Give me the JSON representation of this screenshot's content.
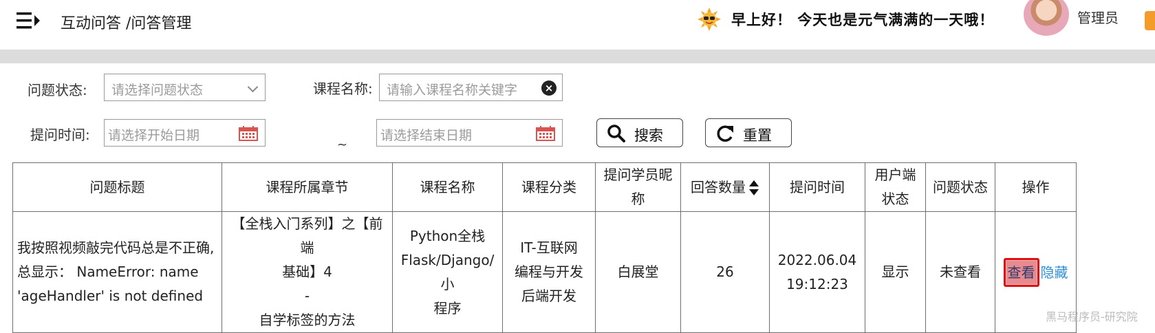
{
  "header": {
    "breadcrumb": "互动问答 /问答管理",
    "greeting": "早上好！ 今天也是元气满满的一天哦！",
    "username": "管理员"
  },
  "filters": {
    "status_label": "问题状态:",
    "status_placeholder": "请选择问题状态",
    "course_label": "课程名称:",
    "course_placeholder": "请输入课程名称关键字",
    "time_label": "提问时间:",
    "start_placeholder": "请选择开始日期",
    "range_sep": "~",
    "end_placeholder": "请选择结束日期",
    "search_label": "搜索",
    "reset_label": "重置"
  },
  "table": {
    "headers": {
      "title": "问题标题",
      "chapter": "课程所属章节",
      "course": "课程名称",
      "category": "课程分类",
      "student": "提问学员昵称",
      "answers": "回答数量",
      "time": "提问时间",
      "user_status_1": "用户端",
      "user_status_2": "状态",
      "status": "问题状态",
      "actions": "操作"
    },
    "rows": [
      {
        "title_1": "我按照视频敲完代码总是不正确,",
        "title_2": "总显示： NameError: name",
        "title_3": "'ageHandler' is not defined",
        "chapter_1": "【全栈入门系列】之【前端",
        "chapter_2": "基础】4",
        "chapter_3": "-",
        "chapter_4": "自学标签的方法",
        "course_1": "Python全栈",
        "course_2": "Flask/Django/小",
        "course_3": "程序",
        "category_1": "IT-互联网",
        "category_2": "编程与开发",
        "category_3": "后端开发",
        "student": "白展堂",
        "answers": "26",
        "date": "2022.06.04",
        "clock": "19:12:23",
        "user_status": "显示",
        "status": "未查看",
        "view_label": "查看",
        "hide_label": "隐藏"
      }
    ]
  },
  "watermark": "黑马程序员-研究院",
  "colors": {
    "view_button": "#e88b90",
    "view_border": "#dd1111",
    "hide_link": "#2f8fd8",
    "calendar_icon": "#d9534f"
  }
}
